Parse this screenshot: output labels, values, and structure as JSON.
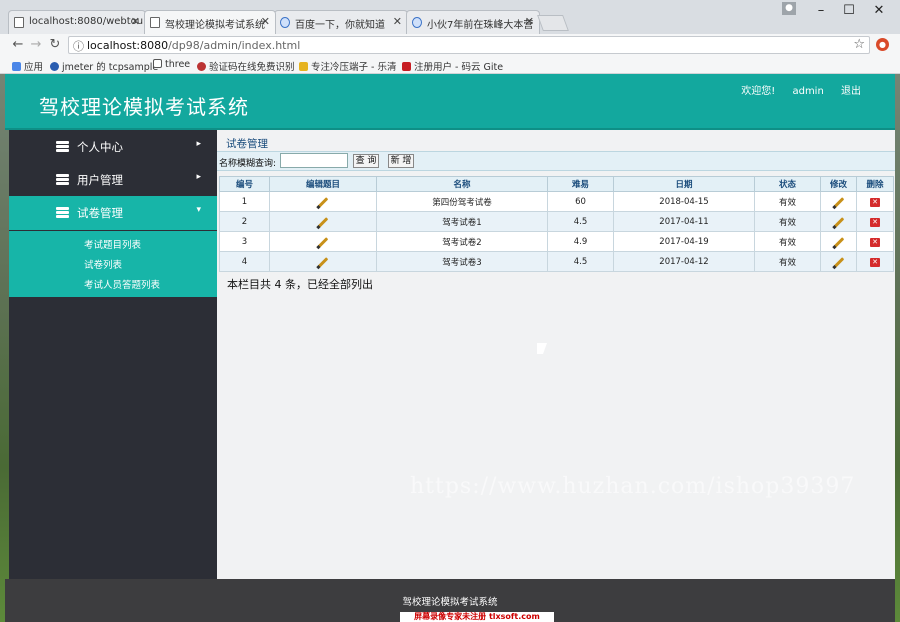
{
  "browser": {
    "tabs": [
      {
        "label": "localhost:8080/webtou",
        "active": false,
        "icon": "page-icon"
      },
      {
        "label": "驾校理论模拟考试系统",
        "active": true,
        "icon": "page-icon"
      },
      {
        "label": "百度一下，你就知道",
        "active": false,
        "icon": "baidu-icon"
      },
      {
        "label": "小伙7年前在珠峰大本营",
        "active": false,
        "icon": "baidu-icon"
      }
    ],
    "url_host": "localhost:8080",
    "url_path": "/dp98/admin/index.html",
    "bookmarks": [
      "应用",
      "jmeter 的 tcpsample",
      "three",
      "验证码在线免费识别",
      "专注冷压端子 - 乐清",
      "注册用户 - 码云 Gite"
    ]
  },
  "header": {
    "title": "驾校理论模拟考试系统",
    "welcome": "欢迎您!",
    "user": "admin",
    "logout": "退出"
  },
  "sidebar": {
    "items": [
      {
        "label": "个人中心",
        "arrow": "▸"
      },
      {
        "label": "用户管理",
        "arrow": "▸"
      },
      {
        "label": "试卷管理",
        "arrow": "▾"
      }
    ],
    "subitems": [
      "考试题目列表",
      "试卷列表",
      "考试人员答题列表"
    ]
  },
  "main": {
    "title": "试卷管理",
    "search_label": "名称模糊查询:",
    "search_value": "",
    "query_button": "查 询",
    "new_button": "新 增",
    "columns": [
      "编号",
      "编辑题目",
      "名称",
      "难易",
      "日期",
      "状态",
      "修改",
      "删除"
    ],
    "rows": [
      {
        "id": "1",
        "name": "第四份驾考试卷",
        "difficulty": "60",
        "date": "2018-04-15",
        "status": "有效"
      },
      {
        "id": "2",
        "name": "驾考试卷1",
        "difficulty": "4.5",
        "date": "2017-04-11",
        "status": "有效"
      },
      {
        "id": "3",
        "name": "驾考试卷2",
        "difficulty": "4.9",
        "date": "2017-04-19",
        "status": "有效"
      },
      {
        "id": "4",
        "name": "驾考试卷3",
        "difficulty": "4.5",
        "date": "2017-04-12",
        "status": "有效"
      }
    ],
    "summary": "本栏目共 4 条，已经全部列出"
  },
  "footer": {
    "text": "驾校理论模拟考试系统"
  },
  "overlay": {
    "watermark": "https://www.huzhan.com/ishop39397",
    "recorder_badge": "屏幕录像专家未注册 tlxsoft.com"
  },
  "colors": {
    "header": "#13a89e",
    "sidebar": "#2c2e36",
    "sidebar_active": "#17b5a8",
    "footer": "#3d3d3f"
  }
}
